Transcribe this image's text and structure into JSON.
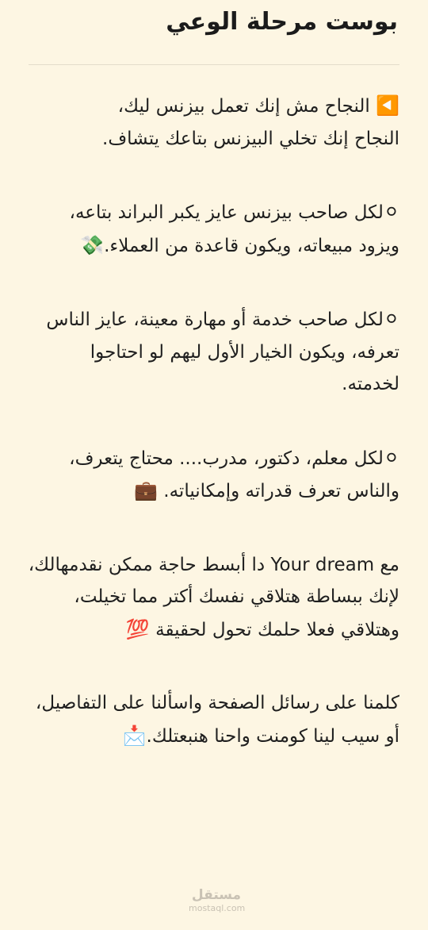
{
  "post": {
    "title": "بوست مرحلة الوعي",
    "paragraphs": [
      {
        "icon": "play-left-icon",
        "emoji": "◀️",
        "text": " النجاح مش إنك تعمل بيزنس ليك،\nالنجاح إنك تخلي البيزنس بتاعك يتشاف."
      },
      {
        "icon": "white-circle-icon",
        "emoji": "⚪",
        "text": "لكل صاحب بيزنس عايز يكبر البراند بتاعه، ويزود مبيعاته، ويكون قاعدة من العملاء.",
        "trailing_emoji": "💸"
      },
      {
        "icon": "white-circle-icon",
        "emoji": "⚪",
        "text": "لكل صاحب خدمة أو مهارة معينة، عايز الناس تعرفه، ويكون الخيار الأول ليهم لو احتاجوا لخدمته."
      },
      {
        "icon": "white-circle-icon",
        "emoji": "⚪",
        "text": "لكل معلم، دكتور، مدرب.... محتاج يتعرف، والناس تعرف قدراته وإمكانياته.",
        "trailing_emoji": "💼"
      },
      {
        "text_before": "مع ",
        "brand": "Your dream",
        "text": " دا أبسط حاجة ممكن نقدمهالك، لإنك ببساطة هتلاقي نفسك أكتر مما تخيلت، وهتلاقي فعلا حلمك تحول لحقيقة ",
        "trailing_emoji": "💯"
      },
      {
        "text": "كلمنا على رسائل الصفحة واسألنا على التفاصيل، أو سيب لينا كومنت واحنا هنبعتلك.",
        "trailing_emoji": "📩"
      }
    ]
  },
  "watermark": {
    "arabic": "مستقل",
    "latin": "mostaql.com"
  }
}
